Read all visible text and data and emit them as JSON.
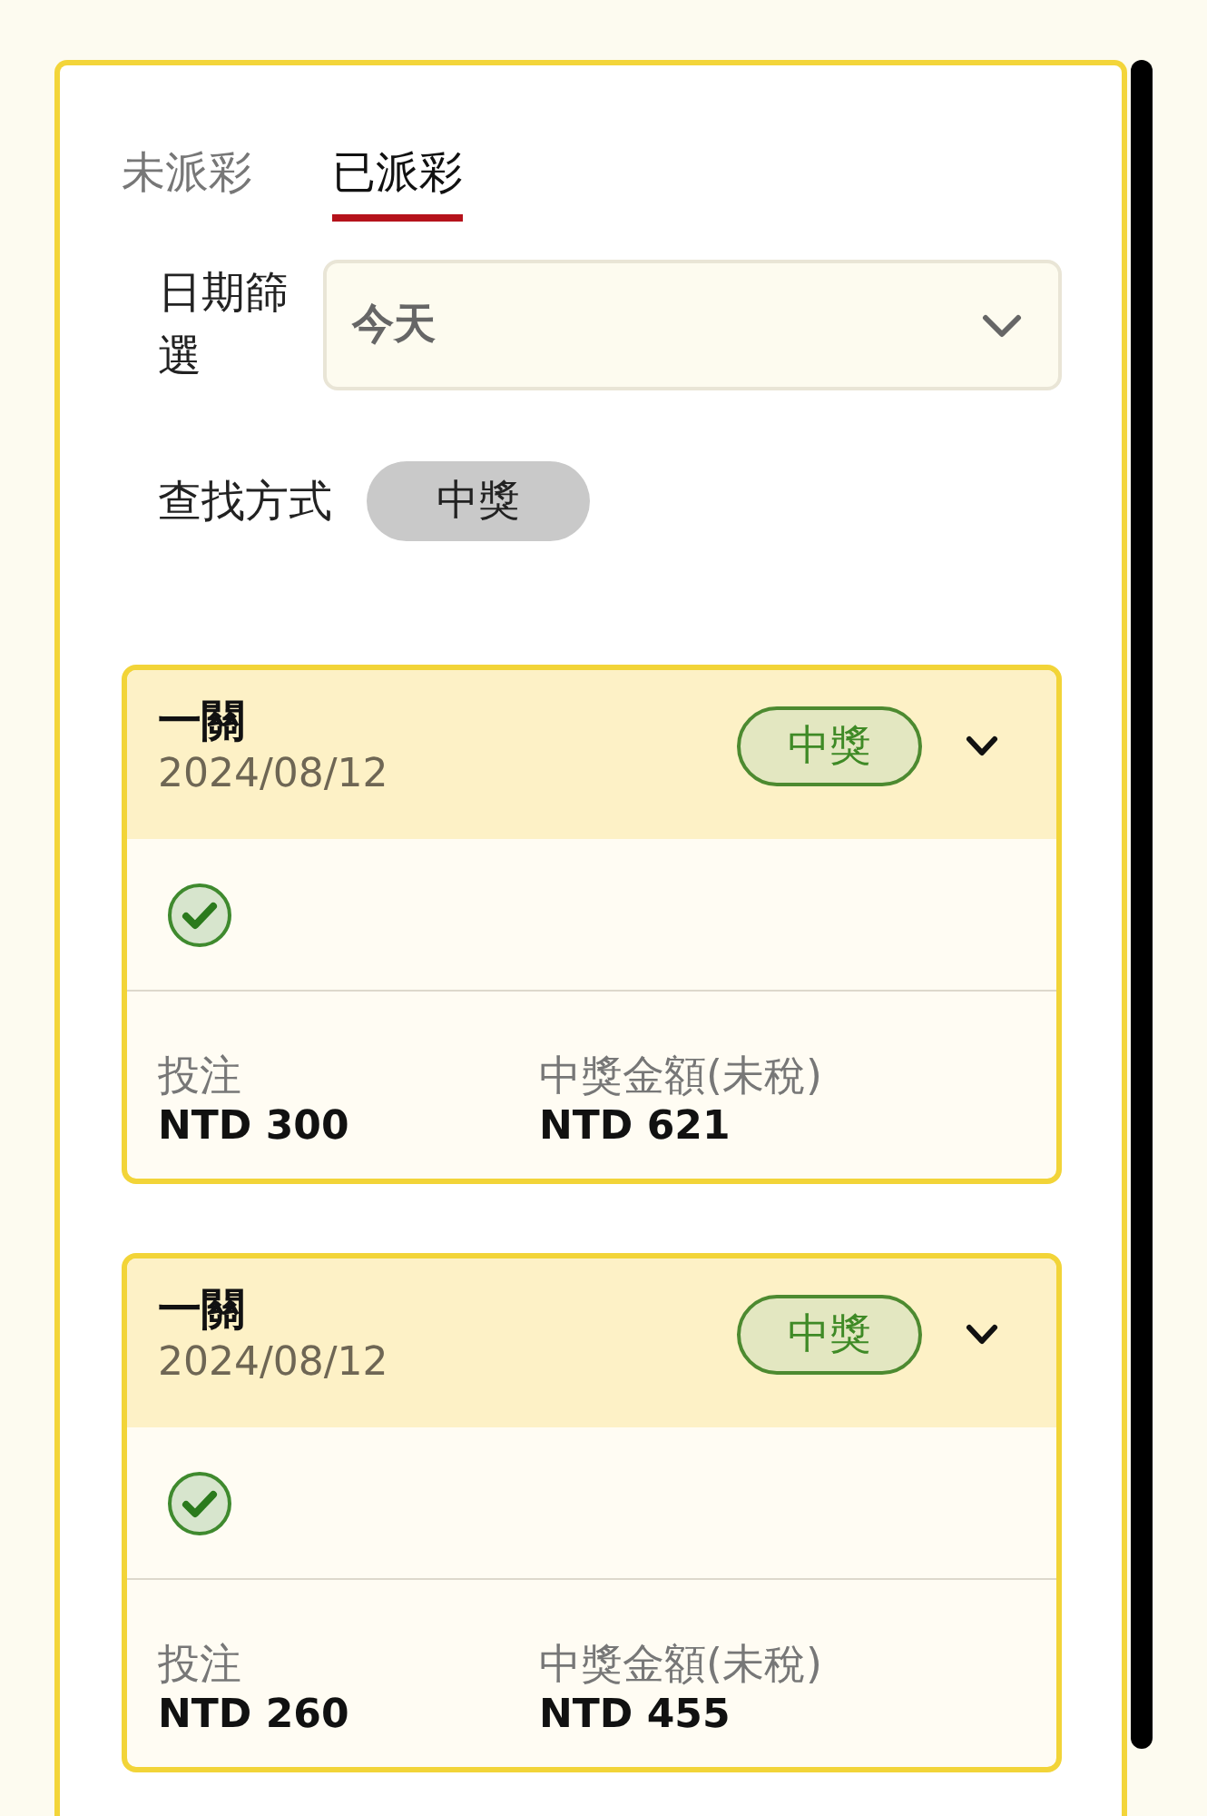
{
  "tabs": [
    {
      "label": "未派彩",
      "selected": false
    },
    {
      "label": "已派彩",
      "selected": true
    }
  ],
  "date_filter": {
    "label": "日期篩選",
    "value": "今天"
  },
  "search_by": {
    "label": "查找方式",
    "chip": "中獎"
  },
  "bets": [
    {
      "title": "一關",
      "date": "2024/08/12",
      "status": "中獎",
      "won": true,
      "stake_label": "投注",
      "stake": "NTD 300",
      "payout_label": "中獎金額(未稅)",
      "payout": "NTD 621"
    },
    {
      "title": "一關",
      "date": "2024/08/12",
      "status": "中獎",
      "won": true,
      "stake_label": "投注",
      "stake": "NTD 260",
      "payout_label": "中獎金額(未稅)",
      "payout": "NTD 455"
    }
  ]
}
